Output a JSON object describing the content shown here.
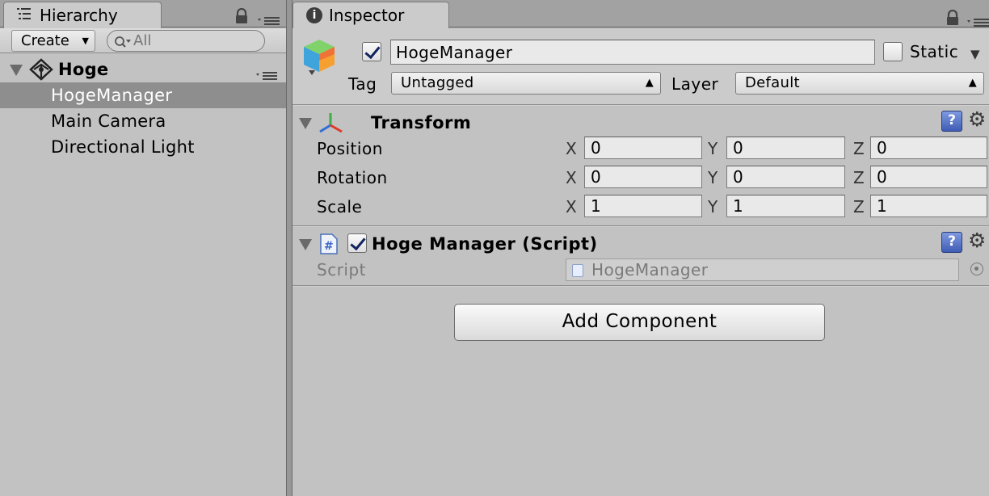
{
  "hierarchy": {
    "tab_label": "Hierarchy",
    "create_label": "Create",
    "search_placeholder": "All",
    "scene_name": "Hoge",
    "items": [
      {
        "label": "HogeManager",
        "selected": true
      },
      {
        "label": "Main Camera",
        "selected": false
      },
      {
        "label": "Directional Light",
        "selected": false
      }
    ]
  },
  "inspector": {
    "tab_label": "Inspector",
    "object_active": true,
    "object_name": "HogeManager",
    "static_label": "Static",
    "static_checked": false,
    "tag_label": "Tag",
    "tag_value": "Untagged",
    "layer_label": "Layer",
    "layer_value": "Default",
    "transform": {
      "title": "Transform",
      "rows": [
        {
          "label": "Position",
          "x": "0",
          "y": "0",
          "z": "0"
        },
        {
          "label": "Rotation",
          "x": "0",
          "y": "0",
          "z": "0"
        },
        {
          "label": "Scale",
          "x": "1",
          "y": "1",
          "z": "1"
        }
      ],
      "axis_x": "X",
      "axis_y": "Y",
      "axis_z": "Z"
    },
    "script_component": {
      "enabled": true,
      "title": "Hoge Manager (Script)",
      "script_label": "Script",
      "script_value": "HogeManager"
    },
    "add_component_label": "Add Component"
  },
  "icons": {
    "list": "list-icon",
    "lock": "lock-icon",
    "menu": "context-menu-icon",
    "info": "info-icon",
    "unity": "unity-logo-icon",
    "cube": "gameobject-cube-icon",
    "transform": "transform-axes-icon",
    "script": "csharp-script-icon",
    "help": "help-book-icon",
    "gear": "gear-icon"
  },
  "colors": {
    "panel_bg": "#c2c2c2",
    "selection": "#8e8e8e",
    "help_icon": "#4a67c0"
  }
}
